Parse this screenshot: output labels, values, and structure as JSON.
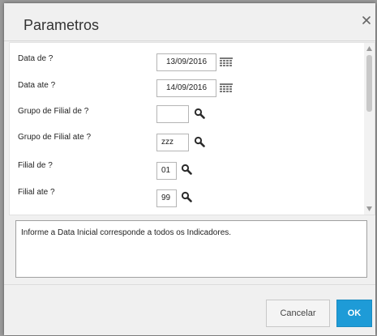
{
  "dialog": {
    "title": "Parametros",
    "close_icon": "close-icon"
  },
  "form": {
    "rows": [
      {
        "label": "Data de ?",
        "value": "13/09/2016",
        "control": "date",
        "icon": "calendar-icon"
      },
      {
        "label": "Data ate ?",
        "value": "14/09/2016",
        "control": "date",
        "icon": "calendar-icon"
      },
      {
        "label": "Grupo de Filial de ?",
        "value": "",
        "control": "lookup",
        "icon": "search-icon"
      },
      {
        "label": "Grupo de Filial ate ?",
        "value": "zzz",
        "control": "lookup",
        "icon": "search-icon"
      },
      {
        "label": "Filial de ?",
        "value": "01",
        "control": "lookup",
        "icon": "search-icon"
      },
      {
        "label": "Filial ate ?",
        "value": "99",
        "control": "lookup",
        "icon": "search-icon"
      }
    ]
  },
  "help": {
    "text": "Informe a Data Inicial corresponde a todos os Indicadores."
  },
  "buttons": {
    "cancel_label": "Cancelar",
    "ok_label": "OK"
  },
  "colors": {
    "ok_button": "#1e9bd7",
    "icon": "#2b2b2b"
  }
}
